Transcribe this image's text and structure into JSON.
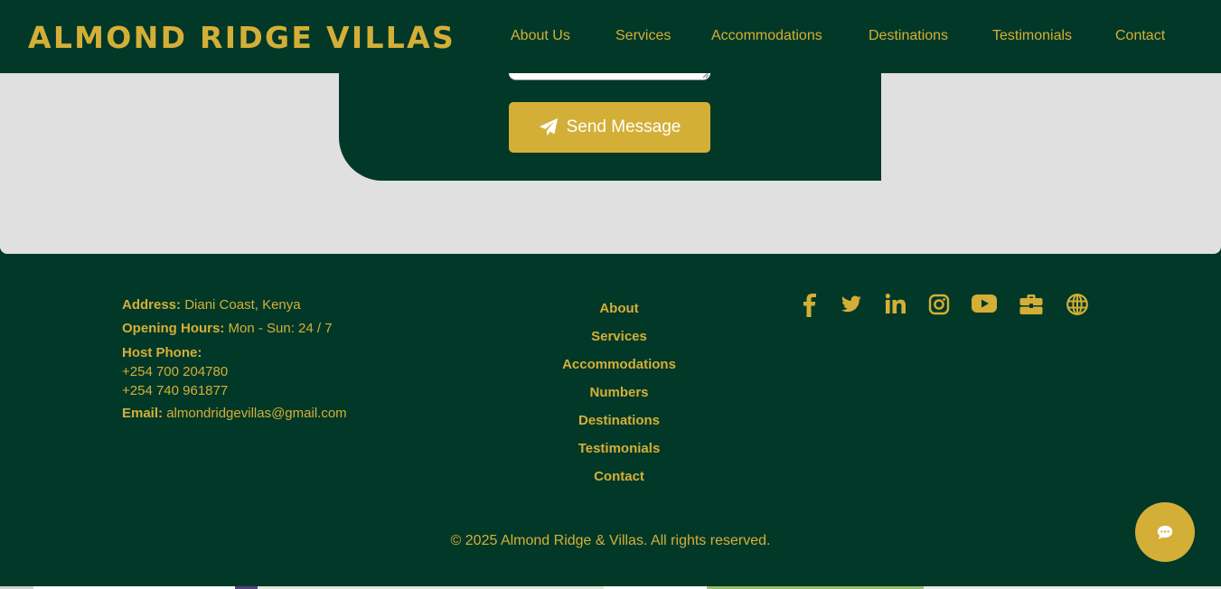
{
  "header": {
    "logo": "ALMOND RIDGE VILLAS",
    "nav": [
      {
        "label": "About Us"
      },
      {
        "label": "Services"
      },
      {
        "label": "Accommodations"
      },
      {
        "label": "Destinations"
      },
      {
        "label": "Testimonials"
      },
      {
        "label": "Contact"
      }
    ]
  },
  "form": {
    "send_label": "Send Message",
    "send_icon": "paper-plane-icon"
  },
  "footer": {
    "address_label": "Address:",
    "address_value": "Diani Coast, Kenya",
    "hours_label": "Opening Hours:",
    "hours_value": "Mon - Sun: 24 / 7",
    "phone_label": "Host Phone:",
    "phones": [
      "+254 700 204780",
      "+254 740 961877"
    ],
    "email_label": "Email:",
    "email_value": "almondridgevillas@gmail.com",
    "links": [
      {
        "label": "About"
      },
      {
        "label": "Services"
      },
      {
        "label": "Accommodations"
      },
      {
        "label": "Numbers"
      },
      {
        "label": "Destinations"
      },
      {
        "label": "Testimonials"
      },
      {
        "label": "Contact"
      }
    ],
    "socials": [
      "facebook-icon",
      "twitter-icon",
      "linkedin-icon",
      "instagram-icon",
      "youtube-icon",
      "briefcase-icon",
      "globe-icon"
    ],
    "copyright": "© 2025 Almond Ridge & Villas. All rights reserved."
  },
  "chat": {
    "icon": "chat-bubble-icon"
  },
  "colors": {
    "primary_green": "#023828",
    "gold": "#d4af37",
    "section_grey": "#e0e0e0",
    "white": "#ffffff"
  }
}
